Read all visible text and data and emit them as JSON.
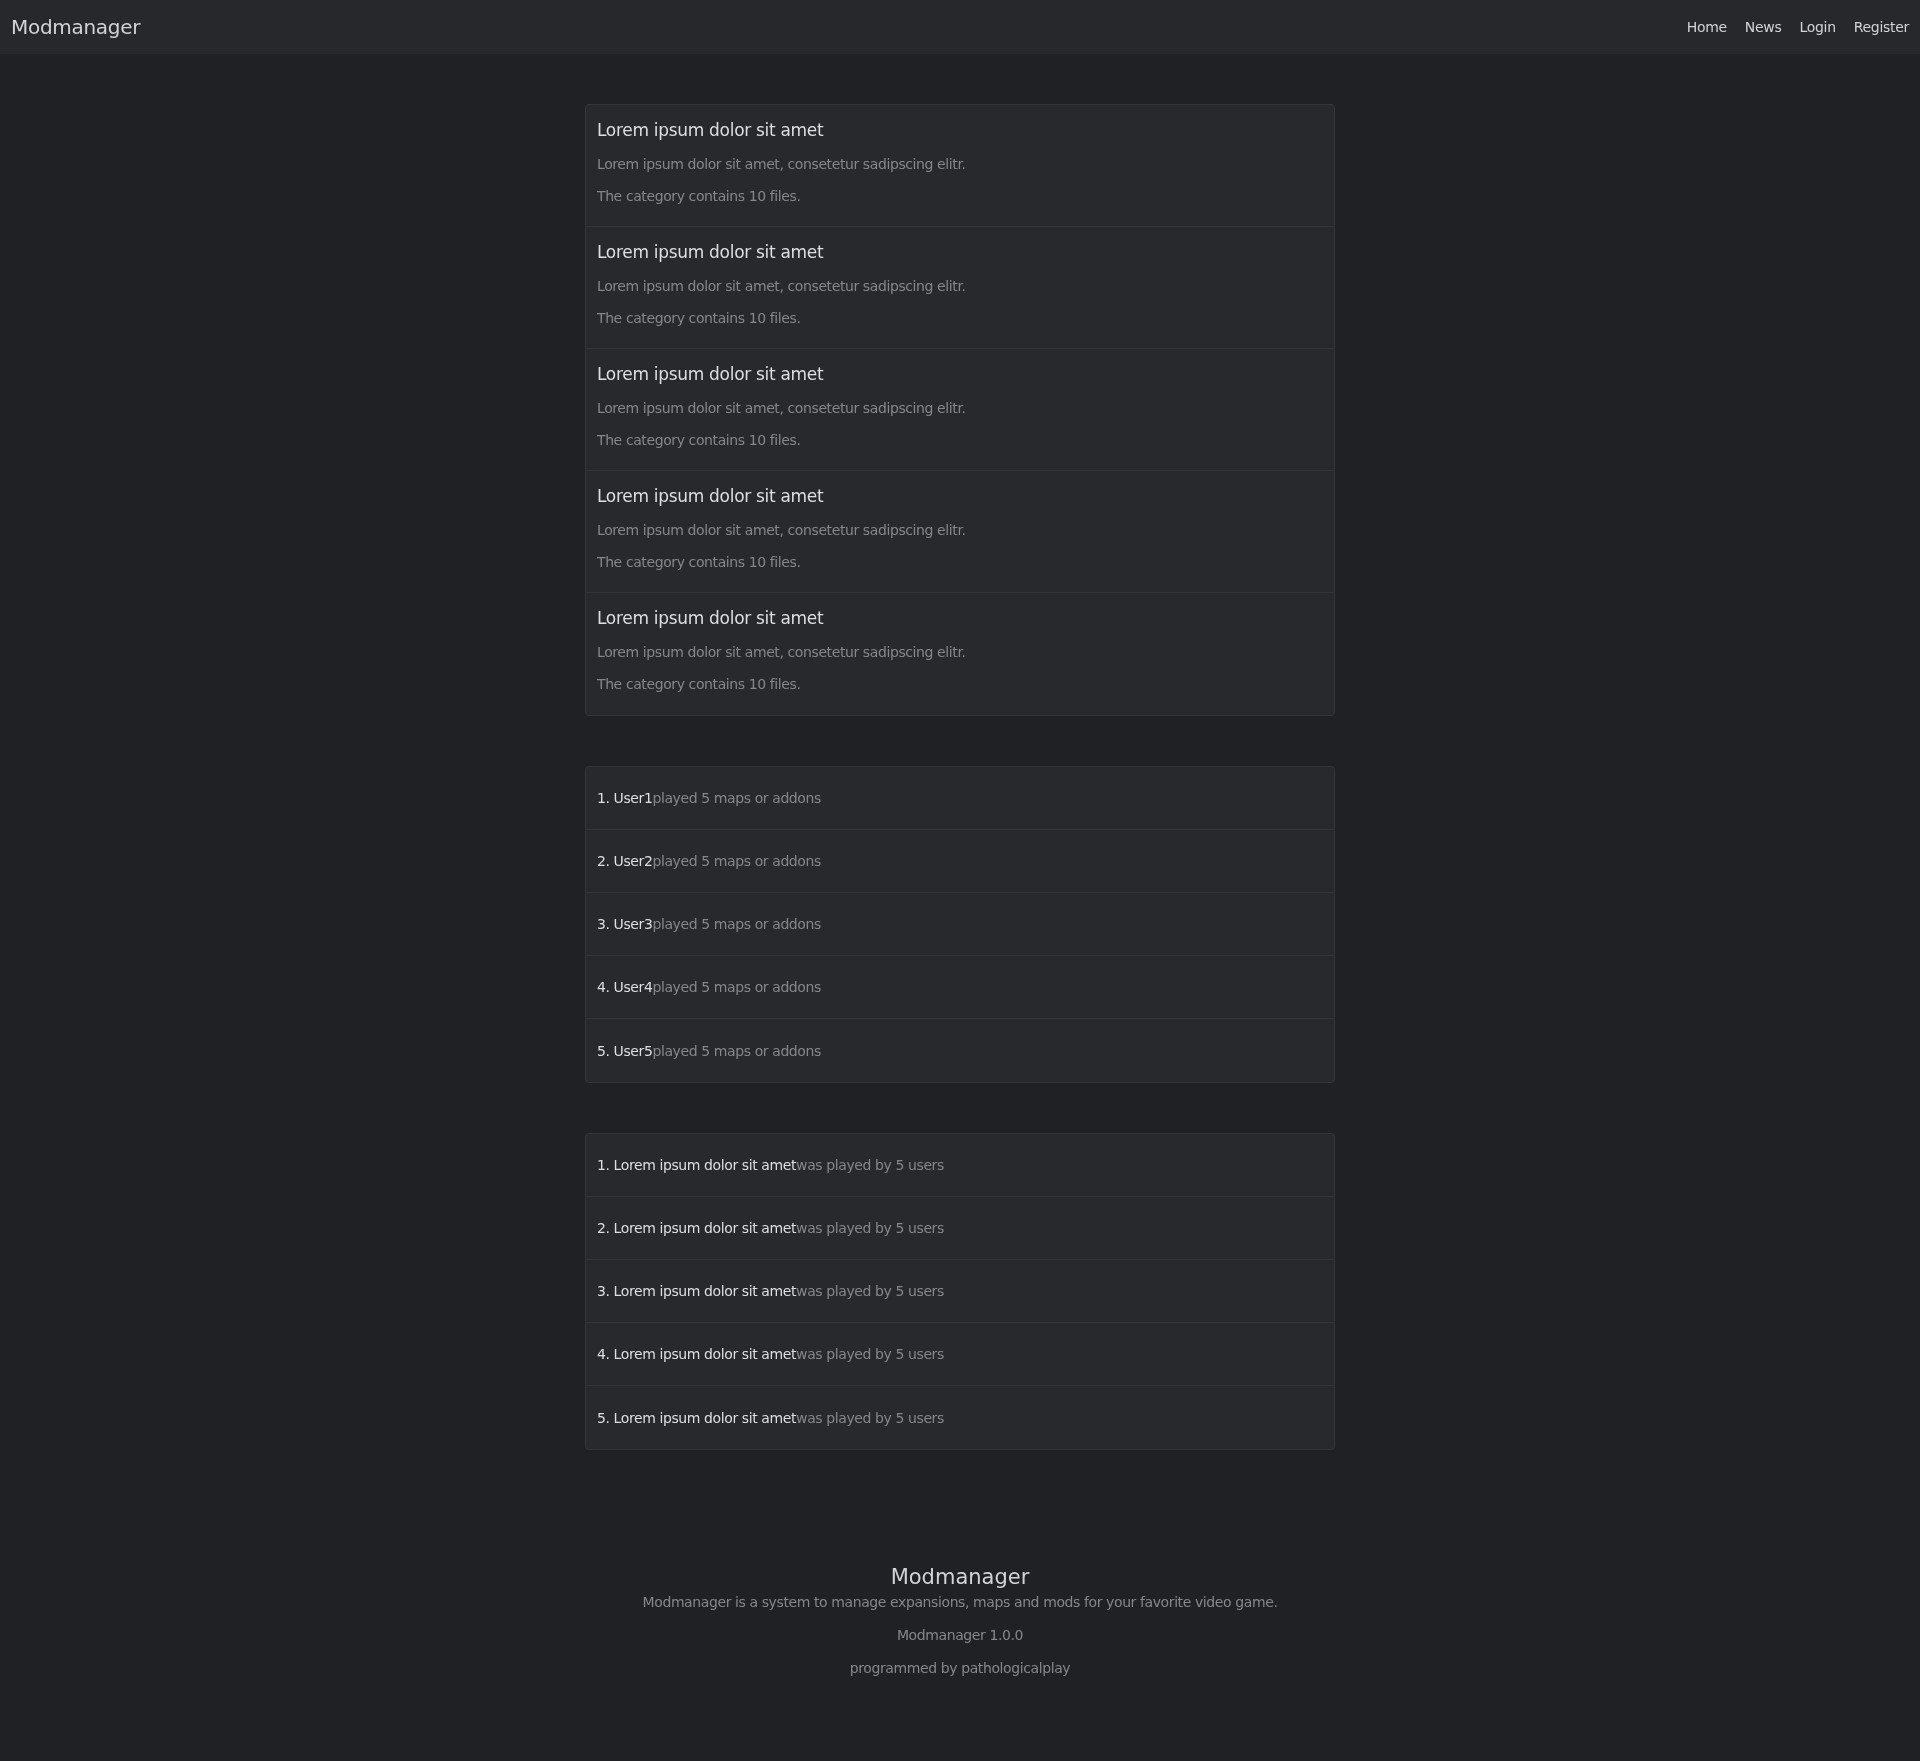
{
  "navbar": {
    "brand": "Modmanager",
    "links": [
      {
        "label": "Home"
      },
      {
        "label": "News"
      },
      {
        "label": "Login"
      },
      {
        "label": "Register"
      }
    ]
  },
  "categories": [
    {
      "title": "Lorem ipsum dolor sit amet",
      "description": "Lorem ipsum dolor sit amet, consetetur sadipscing elitr.",
      "file_count": "The category contains 10 files."
    },
    {
      "title": "Lorem ipsum dolor sit amet",
      "description": "Lorem ipsum dolor sit amet, consetetur sadipscing elitr.",
      "file_count": "The category contains 10 files."
    },
    {
      "title": "Lorem ipsum dolor sit amet",
      "description": "Lorem ipsum dolor sit amet, consetetur sadipscing elitr.",
      "file_count": "The category contains 10 files."
    },
    {
      "title": "Lorem ipsum dolor sit amet",
      "description": "Lorem ipsum dolor sit amet, consetetur sadipscing elitr.",
      "file_count": "The category contains 10 files."
    },
    {
      "title": "Lorem ipsum dolor sit amet",
      "description": "Lorem ipsum dolor sit amet, consetetur sadipscing elitr.",
      "file_count": "The category contains 10 files."
    }
  ],
  "top_users": [
    {
      "lead": "1. User1",
      "rest": "played 5 maps or addons"
    },
    {
      "lead": "2. User2",
      "rest": "played 5 maps or addons"
    },
    {
      "lead": "3. User3",
      "rest": "played 5 maps or addons"
    },
    {
      "lead": "4. User4",
      "rest": "played 5 maps or addons"
    },
    {
      "lead": "5. User5",
      "rest": "played 5 maps or addons"
    }
  ],
  "top_addons": [
    {
      "lead": "1. Lorem ipsum dolor sit amet",
      "rest": "was played by 5 users"
    },
    {
      "lead": "2. Lorem ipsum dolor sit amet",
      "rest": "was played by 5 users"
    },
    {
      "lead": "3. Lorem ipsum dolor sit amet",
      "rest": "was played by 5 users"
    },
    {
      "lead": "4. Lorem ipsum dolor sit amet",
      "rest": "was played by 5 users"
    },
    {
      "lead": "5. Lorem ipsum dolor sit amet",
      "rest": "was played by 5 users"
    }
  ],
  "footer": {
    "title": "Modmanager",
    "description": "Modmanager is a system to manage expansions, maps and mods for your favorite video game.",
    "version": "Modmanager 1.0.0",
    "credit": "programmed by pathologicalplay"
  }
}
